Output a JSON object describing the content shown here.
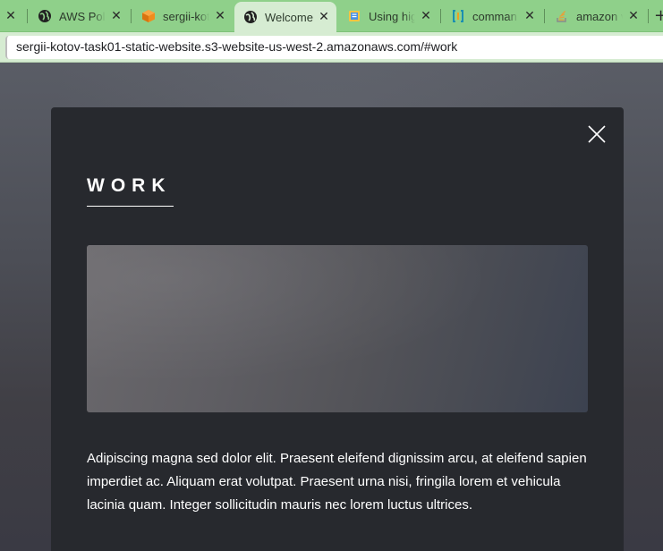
{
  "browser": {
    "tabs": [
      {
        "title": "",
        "icon": "close-icon",
        "active": false
      },
      {
        "title": "AWS Polic",
        "icon": "globe-icon",
        "active": false
      },
      {
        "title": "sergii-kot",
        "icon": "aws-s3-bucket-icon",
        "active": false
      },
      {
        "title": "Welcome",
        "icon": "globe-icon",
        "active": true
      },
      {
        "title": "Using hig",
        "icon": "docs-book-icon",
        "active": false
      },
      {
        "title": "comman",
        "icon": "bracket-doc-icon",
        "active": false
      },
      {
        "title": "amazon v",
        "icon": "stackoverflow-icon",
        "active": false
      }
    ],
    "address": "sergii-kotov-task01-static-website.s3-website-us-west-2.amazonaws.com/#work"
  },
  "modal": {
    "heading": "WORK",
    "description": "Adipiscing magna sed dolor elit. Praesent eleifend dignissim arcu, at eleifend sapien imperdiet ac. Aliquam erat volutpat. Praesent urna nisi, fringila lorem et vehicula lacinia quam. Integer sollicitudin mauris nec lorem luctus ultrices."
  },
  "colors": {
    "tab_strip": "#8fd08a",
    "active_tab": "#d6ecd2",
    "modal_bg": "#27292e"
  }
}
